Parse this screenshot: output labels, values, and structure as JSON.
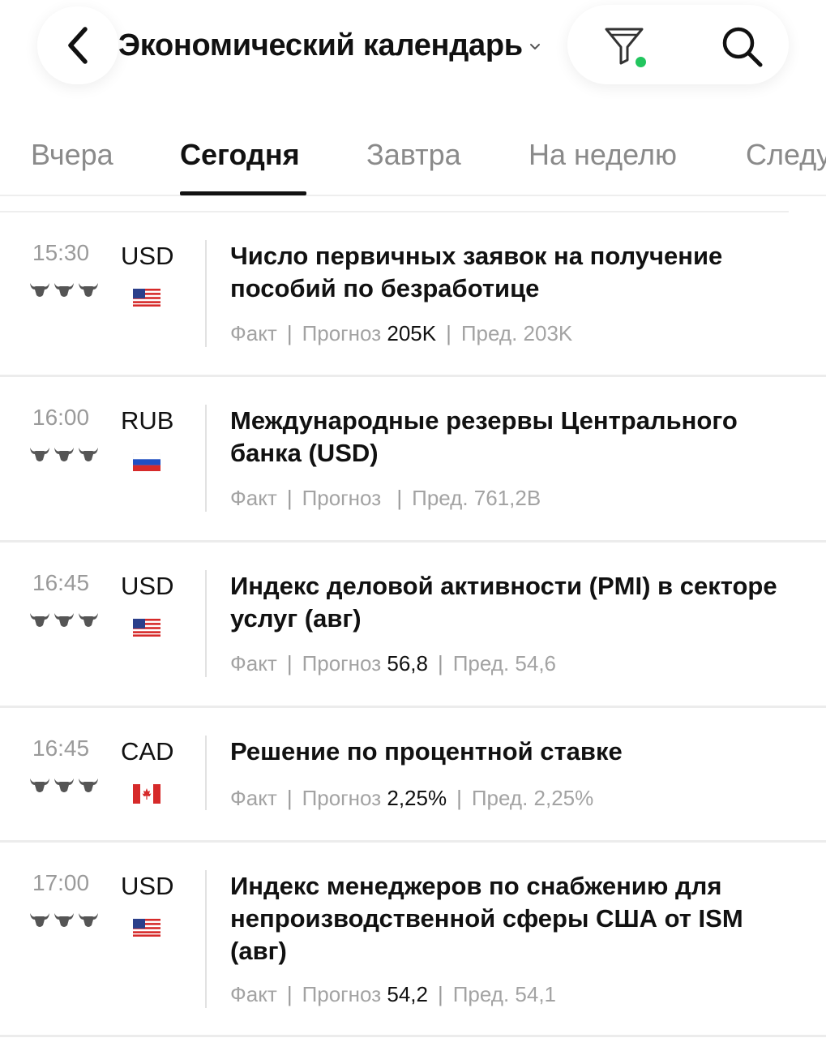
{
  "header": {
    "title": "Экономический календарь",
    "back_icon": "chevron-left-icon",
    "dropdown_icon": "chevron-down-icon",
    "filter_icon": "filter-icon",
    "filter_active_color": "#22c55e",
    "search_icon": "search-icon"
  },
  "tabs": [
    {
      "label": "Вчера",
      "active": false
    },
    {
      "label": "Сегодня",
      "active": true
    },
    {
      "label": "Завтра",
      "active": false
    },
    {
      "label": "На неделю",
      "active": false
    },
    {
      "label": "Следу",
      "active": false
    }
  ],
  "meta_labels": {
    "fact": "Факт",
    "forecast": "Прогноз",
    "prev": "Пред.",
    "separator": "|"
  },
  "events": [
    {
      "time": "15:30",
      "importance": 3,
      "currency": "USD",
      "flag": "us-flag-icon",
      "title": "Число первичных заявок на получение пособий по безработице",
      "forecast": "205K",
      "prev": "203K"
    },
    {
      "time": "16:00",
      "importance": 3,
      "currency": "RUB",
      "flag": "ru-flag-icon",
      "title": "Международные резервы Центрального банка (USD)",
      "forecast": "",
      "prev": "761,2B"
    },
    {
      "time": "16:45",
      "importance": 3,
      "currency": "USD",
      "flag": "us-flag-icon",
      "title": "Индекс деловой активности (PMI) в секторе услуг (авг)",
      "forecast": "56,8",
      "prev": "54,6"
    },
    {
      "time": "16:45",
      "importance": 3,
      "currency": "CAD",
      "flag": "ca-flag-icon",
      "title": "Решение по процентной ставке",
      "forecast": "2,25%",
      "prev": "2,25%"
    },
    {
      "time": "17:00",
      "importance": 3,
      "currency": "USD",
      "flag": "us-flag-icon",
      "title": "Индекс менеджеров по снабжению для непроизводственной сферы США от ISM (авг)",
      "forecast": "54,2",
      "prev": "54,1"
    }
  ]
}
